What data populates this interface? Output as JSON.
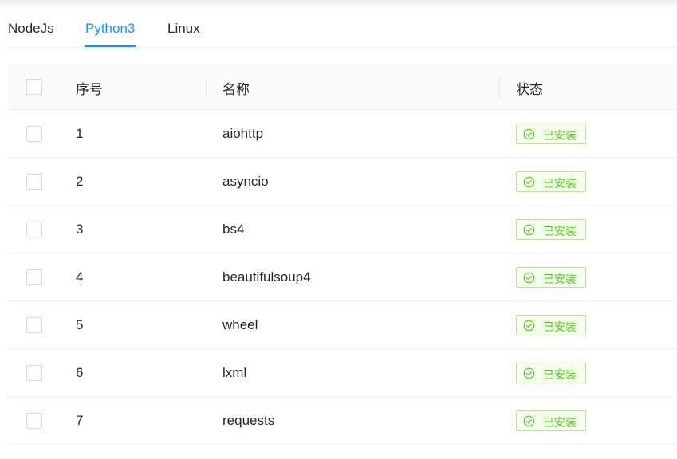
{
  "tabs": [
    {
      "label": "NodeJs"
    },
    {
      "label": "Python3",
      "active": true
    },
    {
      "label": "Linux"
    }
  ],
  "colors": {
    "accent": "#1890ff",
    "success": "#52c41a"
  },
  "table": {
    "headers": {
      "index": "序号",
      "name": "名称",
      "status": "状态"
    },
    "rows": [
      {
        "index": "1",
        "name": "aiohttp",
        "status": "已安装"
      },
      {
        "index": "2",
        "name": "asyncio",
        "status": "已安装"
      },
      {
        "index": "3",
        "name": "bs4",
        "status": "已安装"
      },
      {
        "index": "4",
        "name": "beautifulsoup4",
        "status": "已安装"
      },
      {
        "index": "5",
        "name": "wheel",
        "status": "已安装"
      },
      {
        "index": "6",
        "name": "lxml",
        "status": "已安装"
      },
      {
        "index": "7",
        "name": "requests",
        "status": "已安装"
      }
    ]
  }
}
